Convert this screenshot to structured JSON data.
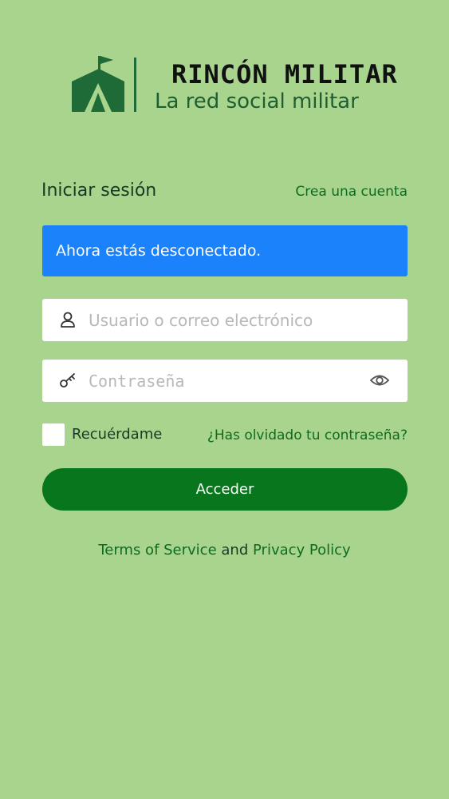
{
  "brand": {
    "name": "RINCÓN MILITAR",
    "tagline": "La red social militar",
    "logo_icon": "tent-flag-icon",
    "color": "#1f6b38"
  },
  "login": {
    "title": "Iniciar sesión",
    "create_account_link": "Crea una cuenta",
    "notice": "Ahora estás desconectado.",
    "username": {
      "placeholder": "Usuario o correo electrónico",
      "value": "",
      "icon": "user-icon"
    },
    "password": {
      "placeholder": "Contraseña",
      "value": "",
      "icon": "key-icon",
      "toggle_icon": "eye-icon"
    },
    "remember_me": {
      "label": "Recuérdame",
      "checked": false
    },
    "forgot_password_link": "¿Has olvidado tu contraseña?",
    "submit_label": "Acceder"
  },
  "footer": {
    "terms_link": "Terms of Service",
    "conjunction": "and",
    "privacy_link": "Privacy Policy"
  },
  "colors": {
    "background": "#a8d48e",
    "accent_button": "#08761c",
    "notice": "#1b82fb",
    "link": "#0f6b1e"
  }
}
